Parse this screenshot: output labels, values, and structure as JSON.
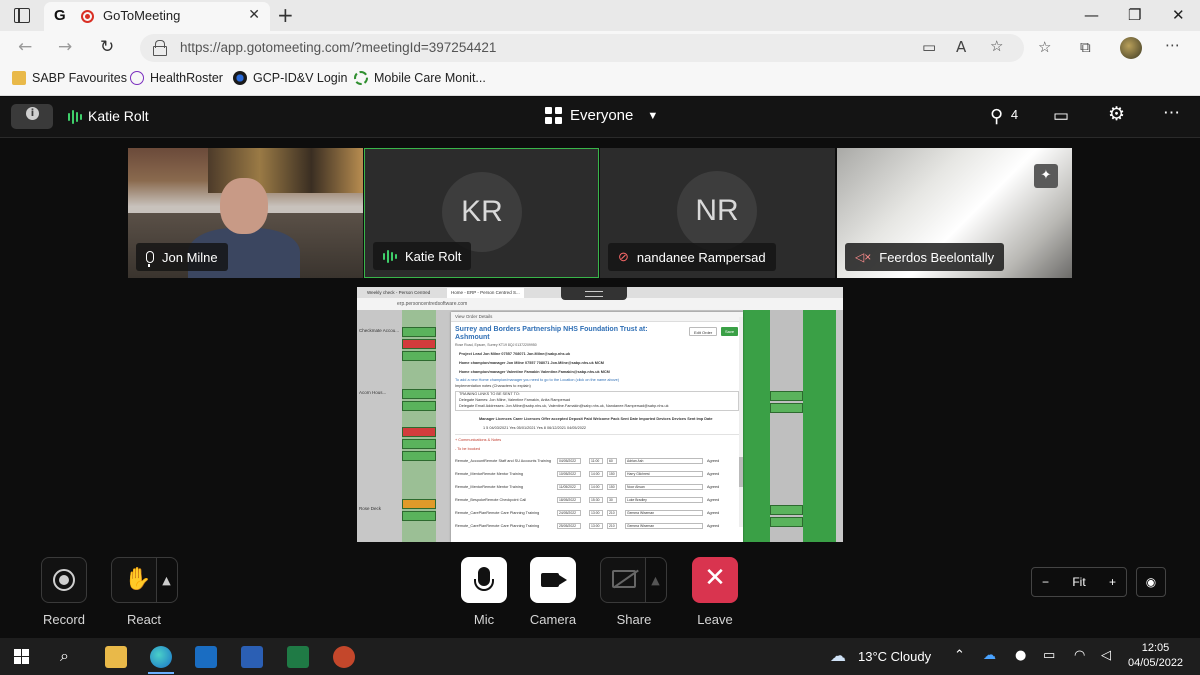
{
  "browser": {
    "tab_title": "GoToMeeting",
    "url": "https://app.gotomeeting.com/?meetingId=397254421",
    "bookmarks": [
      "SABP Favourites",
      "HealthRoster",
      "GCP-ID&V Login",
      "Mobile Care Monit..."
    ]
  },
  "meeting": {
    "active_speaker": "Katie Rolt",
    "view_mode": "Everyone",
    "participant_count": "4",
    "participants": [
      {
        "name": "Jon Milne",
        "initials": "",
        "status": "mic-on"
      },
      {
        "name": "Katie Rolt",
        "initials": "KR",
        "status": "speaking"
      },
      {
        "name": "nandanee Rampersad",
        "initials": "NR",
        "status": "muted"
      },
      {
        "name": "Feerdos Beelontally",
        "initials": "",
        "status": "speaker-off"
      }
    ]
  },
  "shared_screen": {
    "tab1": "Weekly check - Person Centred",
    "tab2": "Home - ERP - Person Centred S...",
    "url": "erp.personcentredsoftware.com",
    "modal_header": "View Order Details",
    "title": "Surrey and Borders Partnership NHS Foundation Trust at: Ashmount",
    "subtitle": "Rose Road, Epsom, Surrey KT19 8QJ  01372209950",
    "edit_btn": "Edit Order",
    "save_btn": "Save",
    "lines": [
      {
        "text": "Project Lead                        Jon Milne           07557 708071   Jon.Milne@sabp.nhs.uk",
        "style": "b"
      },
      {
        "text": "Home champion/manager        Jon Milne           07557 708071   Jon.Milne@sabp.nhs.uk        MCM",
        "style": "b"
      },
      {
        "text": "Home champion/manager        Valentine Famakin    Valentine.Famakin@sabp.nhs.uk              MCM",
        "style": "b"
      },
      {
        "text": "To add a new Home champion/manager you need to go to the Location (click on the name above)",
        "style": "blue"
      },
      {
        "text": "Implementation notes (Characters to explain)",
        "style": ""
      },
      {
        "text": "TRAINING LINKS TO BE SENT TO:",
        "style": ""
      },
      {
        "text": "Delegate Names: Jon Milne, Valentine Famakin, Anita Rampersad",
        "style": ""
      },
      {
        "text": "Delegate Email Addresses: Jon.Milne@sabp.nhs.uk, Valentine.Famakin@sabp.nhs.uk, Nandanee.Rampersad@sabp.nhs.uk",
        "style": ""
      }
    ],
    "licence_header": "Manager Licences   Carer Licences   Offer accepted   Deposit Paid   Welcome Pack Sent   Date Imported   Devices   Devices Sent   Imp Date",
    "licence_values": "1            5          04/03/2021       Yes        05/01/2021          Yes          8        06/12/2021     04/05/2022",
    "section1": "+  Communications & Notes",
    "section2": "-  To be booked",
    "bookings": [
      {
        "name": "Remote_AccountRemote Staff and SU Accounts Training",
        "date": "04/05/2022",
        "time": "11:00",
        "dur": "60",
        "trainer": "Adrian Ash"
      },
      {
        "name": "Remote_MentorRemote Mentor Training",
        "date": "10/05/2022",
        "time": "14:00",
        "dur": "150",
        "trainer": "Harry Gilchrest"
      },
      {
        "name": "Remote_MentorRemote Mentor Training",
        "date": "11/05/2022",
        "time": "14:00",
        "dur": "150",
        "trainer": "Noor Ahsan"
      },
      {
        "name": "Remote_BespokeRemote Checkpoint Call",
        "date": "18/05/2022",
        "time": "15:30",
        "dur": "30",
        "trainer": "Luke Bradley"
      },
      {
        "name": "Remote_CarePlanRemote Care Planning Training",
        "date": "24/05/2022",
        "time": "13:00",
        "dur": "210",
        "trainer": "Gemma Wiseman"
      },
      {
        "name": "Remote_CarePlanRemote Care Planning Training",
        "date": "25/05/2022",
        "time": "13:00",
        "dur": "210",
        "trainer": "Gemma Wiseman"
      }
    ],
    "agreed": "Agreed",
    "row_labels": [
      "Checkmate Accou...",
      "Acorn Hous...",
      "Rose Deck"
    ]
  },
  "controls": {
    "record": "Record",
    "react": "React",
    "mic": "Mic",
    "camera": "Camera",
    "share": "Share",
    "leave": "Leave",
    "zoom_minus": "−",
    "zoom_level": "Fit",
    "zoom_plus": "+"
  },
  "taskbar": {
    "weather": "13°C  Cloudy",
    "time": "12:05",
    "date": "04/05/2022"
  },
  "colors": {
    "accent_green": "#3fcf6a",
    "leave_red": "#d9344f",
    "active_border": "#39b54a"
  }
}
